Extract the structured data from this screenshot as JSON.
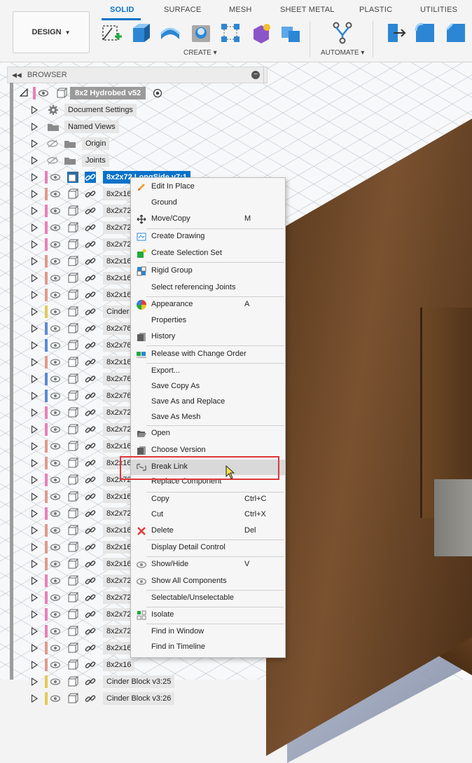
{
  "toolbar": {
    "design_label": "DESIGN",
    "tabs": [
      "SOLID",
      "SURFACE",
      "MESH",
      "SHEET METAL",
      "PLASTIC",
      "UTILITIES"
    ],
    "groups": [
      "CREATE",
      "AUTOMATE"
    ]
  },
  "browser": {
    "title": "BROWSER",
    "root": "8x2 Hydrobed v52",
    "items": [
      {
        "label": "Document Settings"
      },
      {
        "label": "Named Views"
      },
      {
        "label": "Origin"
      },
      {
        "label": "Joints"
      },
      {
        "label": "8x2x72 LongSide v7:1"
      },
      {
        "label": "8x2x16"
      },
      {
        "label": "8x2x72"
      },
      {
        "label": "8x2x72"
      },
      {
        "label": "8x2x72"
      },
      {
        "label": "8x2x16"
      },
      {
        "label": "8x2x16"
      },
      {
        "label": "8x2x16"
      },
      {
        "label": "Cinder B"
      },
      {
        "label": "8x2x76"
      },
      {
        "label": "8x2x76"
      },
      {
        "label": "8x2x16"
      },
      {
        "label": "8x2x76"
      },
      {
        "label": "8x2x76"
      },
      {
        "label": "8x2x72"
      },
      {
        "label": "8x2x72"
      },
      {
        "label": "8x2x16"
      },
      {
        "label": "8x2x16"
      },
      {
        "label": "8x2x72"
      },
      {
        "label": "8x2x16"
      },
      {
        "label": "8x2x72"
      },
      {
        "label": "8x2x16"
      },
      {
        "label": "8x2x16"
      },
      {
        "label": "8x2x16"
      },
      {
        "label": "8x2x72"
      },
      {
        "label": "8x2x72"
      },
      {
        "label": "8x2x72"
      },
      {
        "label": "8x2x72"
      },
      {
        "label": "8x2x16"
      },
      {
        "label": "8x2x16"
      },
      {
        "label": "Cinder Block v3:25"
      },
      {
        "label": "Cinder Block v3:26"
      }
    ]
  },
  "menu": {
    "items": [
      {
        "label": "Edit In Place",
        "key": ""
      },
      {
        "label": "Ground",
        "key": ""
      },
      {
        "label": "Move/Copy",
        "key": "M"
      },
      {
        "label": "Create Drawing",
        "key": ""
      },
      {
        "label": "Create Selection Set",
        "key": ""
      },
      {
        "label": "Rigid Group",
        "key": ""
      },
      {
        "label": "Select referencing Joints",
        "key": ""
      },
      {
        "label": "Appearance",
        "key": "A"
      },
      {
        "label": "Properties",
        "key": ""
      },
      {
        "label": "History",
        "key": ""
      },
      {
        "label": "Release with Change Order",
        "key": ""
      },
      {
        "label": "Export...",
        "key": ""
      },
      {
        "label": "Save Copy As",
        "key": ""
      },
      {
        "label": "Save As and Replace",
        "key": ""
      },
      {
        "label": "Save As Mesh",
        "key": ""
      },
      {
        "label": "Open",
        "key": ""
      },
      {
        "label": "Choose Version",
        "key": ""
      },
      {
        "label": "Break Link",
        "key": ""
      },
      {
        "label": "Replace Component",
        "key": ""
      },
      {
        "label": "Copy",
        "key": "Ctrl+C"
      },
      {
        "label": "Cut",
        "key": "Ctrl+X"
      },
      {
        "label": "Delete",
        "key": "Del"
      },
      {
        "label": "Display Detail Control",
        "key": ""
      },
      {
        "label": "Show/Hide",
        "key": "V"
      },
      {
        "label": "Show All Components",
        "key": ""
      },
      {
        "label": "Selectable/Unselectable",
        "key": ""
      },
      {
        "label": "Isolate",
        "key": ""
      },
      {
        "label": "Find in Window",
        "key": ""
      },
      {
        "label": "Find in Timeline",
        "key": ""
      }
    ]
  },
  "colors": {
    "accent": "#0a72c9",
    "highlight_box": "#e0363a",
    "pink": "#e880b8",
    "salmon": "#e09a8c",
    "blue": "#5b8ad6",
    "yellow": "#e3c95a"
  }
}
